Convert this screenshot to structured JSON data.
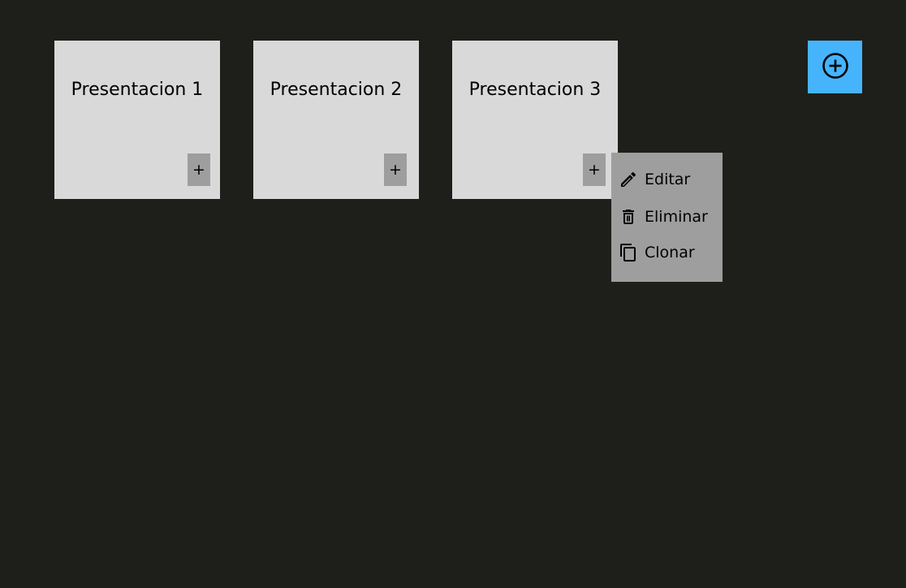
{
  "cards": [
    {
      "title": "Presentacion 1",
      "add_label": "+"
    },
    {
      "title": "Presentacion 2",
      "add_label": "+"
    },
    {
      "title": "Presentacion 3",
      "add_label": "+"
    }
  ],
  "new_button": {
    "icon": "plus-circle-icon"
  },
  "context_menu": {
    "items": [
      {
        "label": "Editar",
        "icon": "pencil-icon"
      },
      {
        "label": "Eliminar",
        "icon": "trash-icon"
      },
      {
        "label": "Clonar",
        "icon": "copy-icon"
      }
    ]
  },
  "colors": {
    "background": "#1e1f1a",
    "card": "#d9d9d9",
    "card_button": "#9e9e9e",
    "accent": "#45b4fd",
    "menu": "#9e9e9e"
  }
}
